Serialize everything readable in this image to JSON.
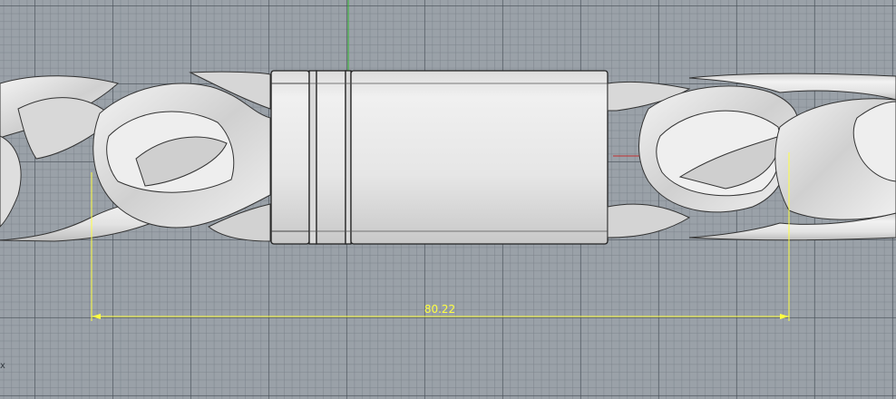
{
  "viewport": {
    "background": "#9aa1a8",
    "grid_major": "#4a525a",
    "grid_minor": "#7a828a",
    "green_axis_color": "#2db82d",
    "red_axis_color": "#c03030"
  },
  "model": {
    "chain_links": "cuban-link-chain",
    "clasp": "cylindrical-box-clasp",
    "metal_color": "#e6e6e6"
  },
  "dimension": {
    "value": "80.22",
    "color": "#ffff40"
  },
  "axis": {
    "label": "x"
  }
}
